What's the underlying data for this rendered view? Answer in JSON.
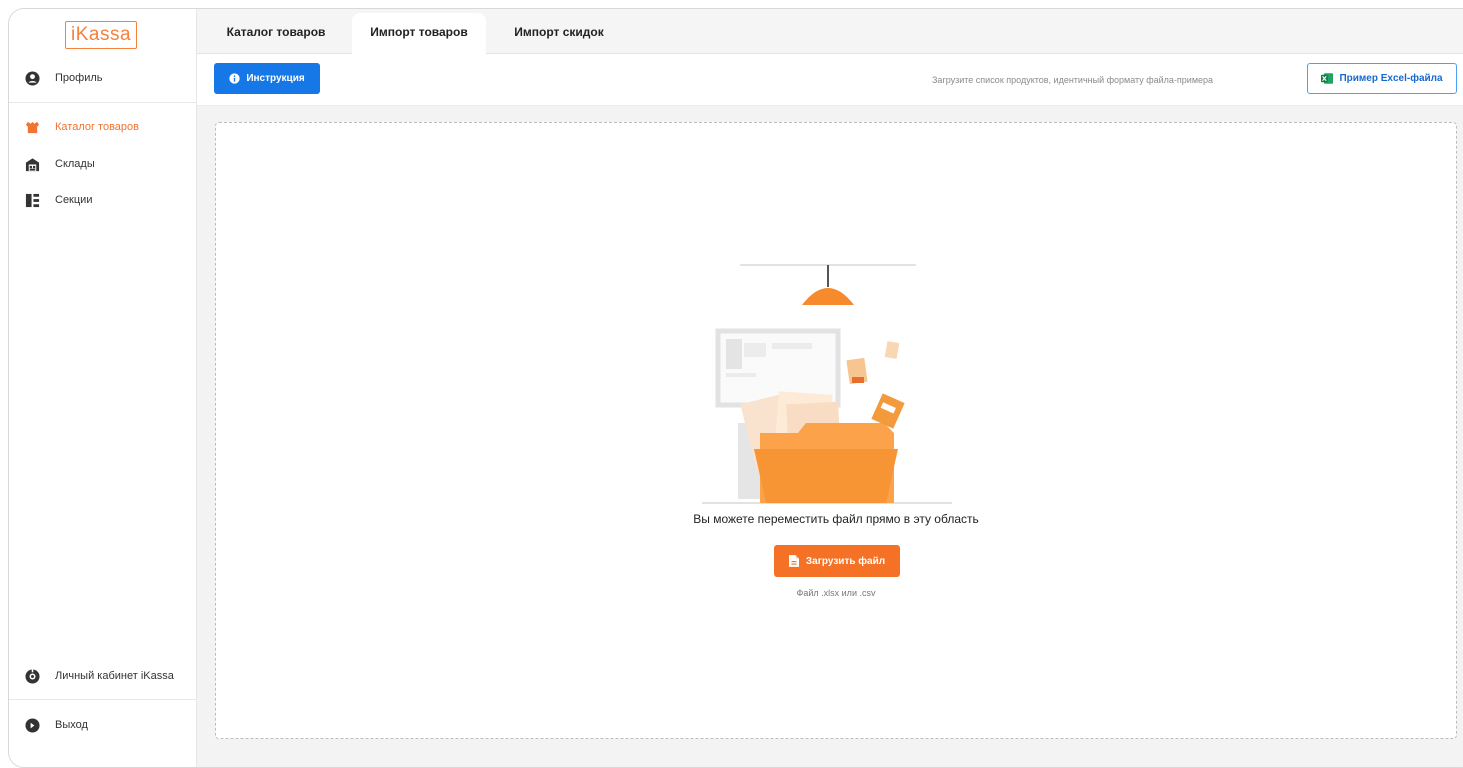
{
  "sidebar": {
    "logo": "iKassa",
    "items": [
      {
        "label": "Профиль",
        "icon": "user-circle-icon"
      },
      {
        "label": "Каталог товаров",
        "icon": "catalog-icon"
      },
      {
        "label": "Склады",
        "icon": "warehouse-icon"
      },
      {
        "label": "Секции",
        "icon": "sections-icon"
      }
    ],
    "bottom_items": [
      {
        "label": "Личный кабинет iKassa",
        "icon": "cabinet-icon"
      },
      {
        "label": "Выход",
        "icon": "logout-icon"
      }
    ]
  },
  "tabs": [
    {
      "label": "Каталог товаров",
      "active": false
    },
    {
      "label": "Импорт товаров",
      "active": true
    },
    {
      "label": "Импорт скидок",
      "active": false
    }
  ],
  "toolbar": {
    "instruction_label": "Инструкция",
    "hint": "Загрузите список продуктов, идентичный формату файла-примера",
    "excel_label": "Пример Excel-файла"
  },
  "dropzone": {
    "text": "Вы можете переместить файл прямо в эту область",
    "upload_label": "Загрузить файл",
    "formats": "Файл .xlsx или .csv",
    "illustration": "folder-illustration"
  },
  "colors": {
    "accent": "#f47125",
    "primary": "#1677e6",
    "active_text": "#f07432"
  }
}
